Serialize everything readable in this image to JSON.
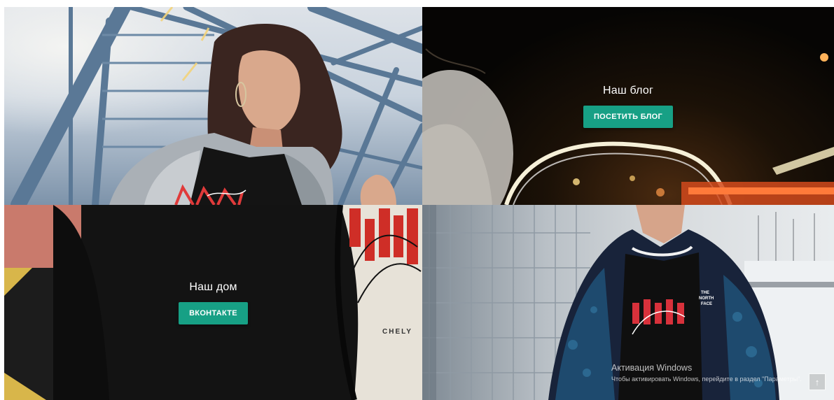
{
  "tiles": [
    {
      "id": "photo-girl-stairs"
    },
    {
      "id": "blog",
      "title": "Наш блог",
      "button": "ПОСЕТИТЬ БЛОГ"
    },
    {
      "id": "vk",
      "title": "Наш дом",
      "button": "ВКОНТАКТЕ"
    },
    {
      "id": "photo-guy-fence"
    }
  ],
  "watermark": {
    "title": "Активация Windows",
    "subtitle": "Чтобы активировать Windows, перейдите в раздел \"Параметры\"."
  },
  "scroll_top_icon": "arrow-up-icon",
  "colors": {
    "button": "#17a085",
    "button_text": "#ffffff"
  }
}
